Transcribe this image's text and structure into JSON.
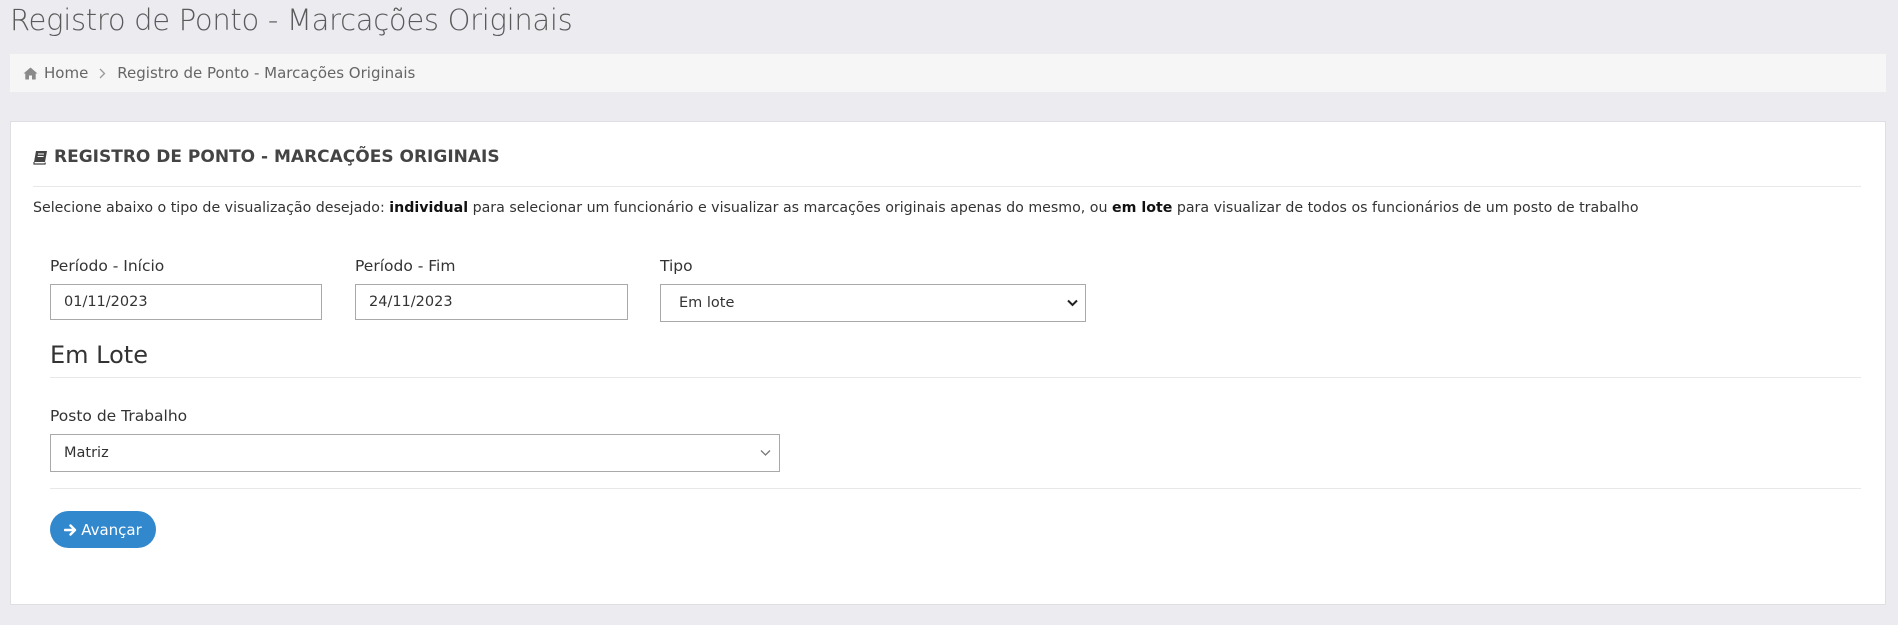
{
  "page": {
    "title": "Registro de Ponto - Marcações Originais"
  },
  "breadcrumb": {
    "home_label": "Home",
    "current_label": "Registro de Ponto - Marcações Originais"
  },
  "panel": {
    "heading": "REGISTRO DE PONTO - MARCAÇÕES ORIGINAIS",
    "description": {
      "part1": "Selecione abaixo o tipo de visualização desejado: ",
      "bold1": "individual",
      "part2": " para selecionar um funcionário e visualizar as marcações originais apenas do mesmo, ou ",
      "bold2": "em lote",
      "part3": " para visualizar de todos os funcionários de um posto de trabalho"
    }
  },
  "form": {
    "period_start": {
      "label": "Período - Início",
      "value": "01/11/2023"
    },
    "period_end": {
      "label": "Período - Fim",
      "value": "24/11/2023"
    },
    "type": {
      "label": "Tipo",
      "selected": "Em lote"
    }
  },
  "batch": {
    "section_title": "Em Lote",
    "workstation": {
      "label": "Posto de Trabalho",
      "selected": "Matriz"
    }
  },
  "actions": {
    "advance_label": "Avançar"
  },
  "colors": {
    "primary": "#3288cd",
    "background": "#ebebf0",
    "panel": "#ffffff",
    "breadcrumb_bg": "#f6f6f6"
  },
  "icons": {
    "breadcrumb_home": "home-icon",
    "breadcrumb_separator": "chevron-right-icon",
    "panel_heading": "book-icon",
    "select_arrow": "chevron-down-icon",
    "button": "arrow-right-icon"
  }
}
